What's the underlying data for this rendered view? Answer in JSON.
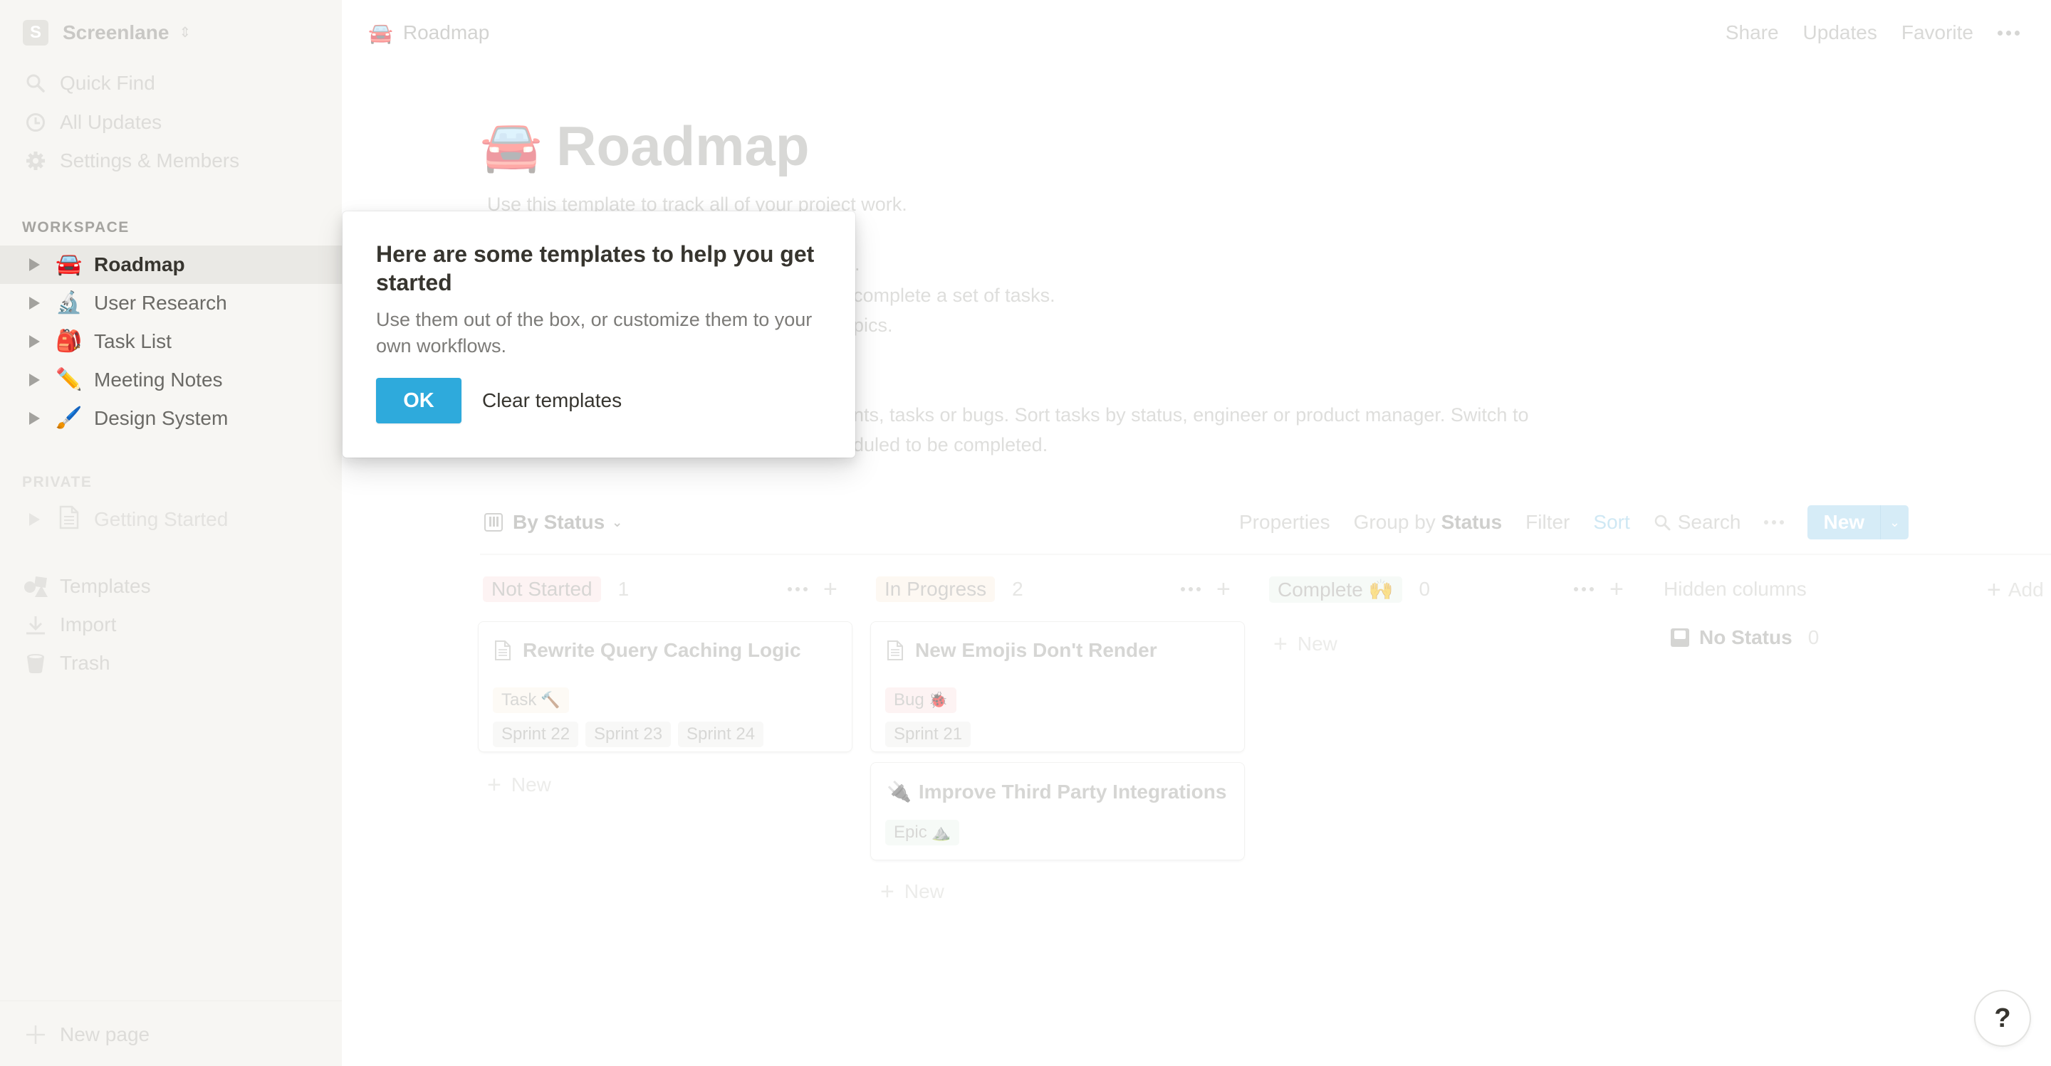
{
  "sidebar": {
    "workspace": {
      "initial": "S",
      "name": "Screenlane"
    },
    "links": [
      {
        "label": "Quick Find",
        "icon": "search-icon"
      },
      {
        "label": "All Updates",
        "icon": "clock-icon"
      },
      {
        "label": "Settings & Members",
        "icon": "gear-icon"
      }
    ],
    "workspace_section": "WORKSPACE",
    "workspace_pages": [
      {
        "emoji": "🚘",
        "label": "Roadmap",
        "active": true
      },
      {
        "emoji": "🔬",
        "label": "User Research"
      },
      {
        "emoji": "🎒",
        "label": "Task List"
      },
      {
        "emoji": "✏️",
        "label": "Meeting Notes"
      },
      {
        "emoji": "🖌️",
        "label": "Design System"
      }
    ],
    "private_section": "PRIVATE",
    "private_pages": [
      {
        "emoji": "📄",
        "label": "Getting Started"
      }
    ],
    "bottom_links": [
      {
        "label": "Templates",
        "icon": "shapes-icon"
      },
      {
        "label": "Import",
        "icon": "download-icon"
      },
      {
        "label": "Trash",
        "icon": "trash-icon"
      }
    ],
    "new_page": "New page"
  },
  "topbar": {
    "breadcrumb": {
      "emoji": "🚘",
      "label": "Roadmap"
    },
    "actions": {
      "share": "Share",
      "updates": "Updates",
      "favorite": "Favorite"
    }
  },
  "page": {
    "emoji": "🚘",
    "title": "Roadmap",
    "description_lines": [
      "Use this template to track all of your project work.",
      ".",
      "complete a set of tasks.",
      "pics.",
      "nts, tasks or bugs. Sort tasks by status, engineer or product manager. Switch to",
      "duled to be completed."
    ]
  },
  "board": {
    "view": "By Status",
    "toolbar": {
      "properties": "Properties",
      "group_by_prefix": "Group by",
      "group_by_value": "Status",
      "filter": "Filter",
      "sort": "Sort",
      "search": "Search",
      "new": "New"
    },
    "columns": [
      {
        "name": "Not Started",
        "count": "1",
        "color": "#fdf3f3",
        "cards": [
          {
            "title": "Rewrite Query Caching Logic",
            "icon": "page-icon",
            "type": {
              "label": "Task",
              "emoji": "🔨"
            },
            "sprints": [
              "Sprint 22",
              "Sprint 23",
              "Sprint 24"
            ]
          }
        ]
      },
      {
        "name": "In Progress",
        "count": "2",
        "color": "#fdf8f2",
        "cards": [
          {
            "title": "New Emojis Don't Render",
            "icon": "page-icon",
            "type": {
              "label": "Bug",
              "emoji": "🐞"
            },
            "sprints": [
              "Sprint 21"
            ]
          },
          {
            "title": "Improve Third Party Integrations",
            "emoji": "🔌",
            "type": {
              "label": "Epic",
              "emoji": "⛰️"
            },
            "sprints": []
          }
        ]
      },
      {
        "name": "Complete",
        "emoji": "🙌",
        "count": "0",
        "color": "#f6faf7",
        "cards": []
      }
    ],
    "add_new_label": "New",
    "hidden_columns_label": "Hidden columns",
    "no_status": {
      "label": "No Status",
      "count": "0"
    },
    "add_group_label": "Add"
  },
  "dialog": {
    "title": "Here are some templates to help you get started",
    "body": "Use them out of the box, or customize them to your own workflows.",
    "ok": "OK",
    "clear": "Clear templates",
    "accent": "#2eaadc"
  },
  "help": {
    "label": "?"
  }
}
